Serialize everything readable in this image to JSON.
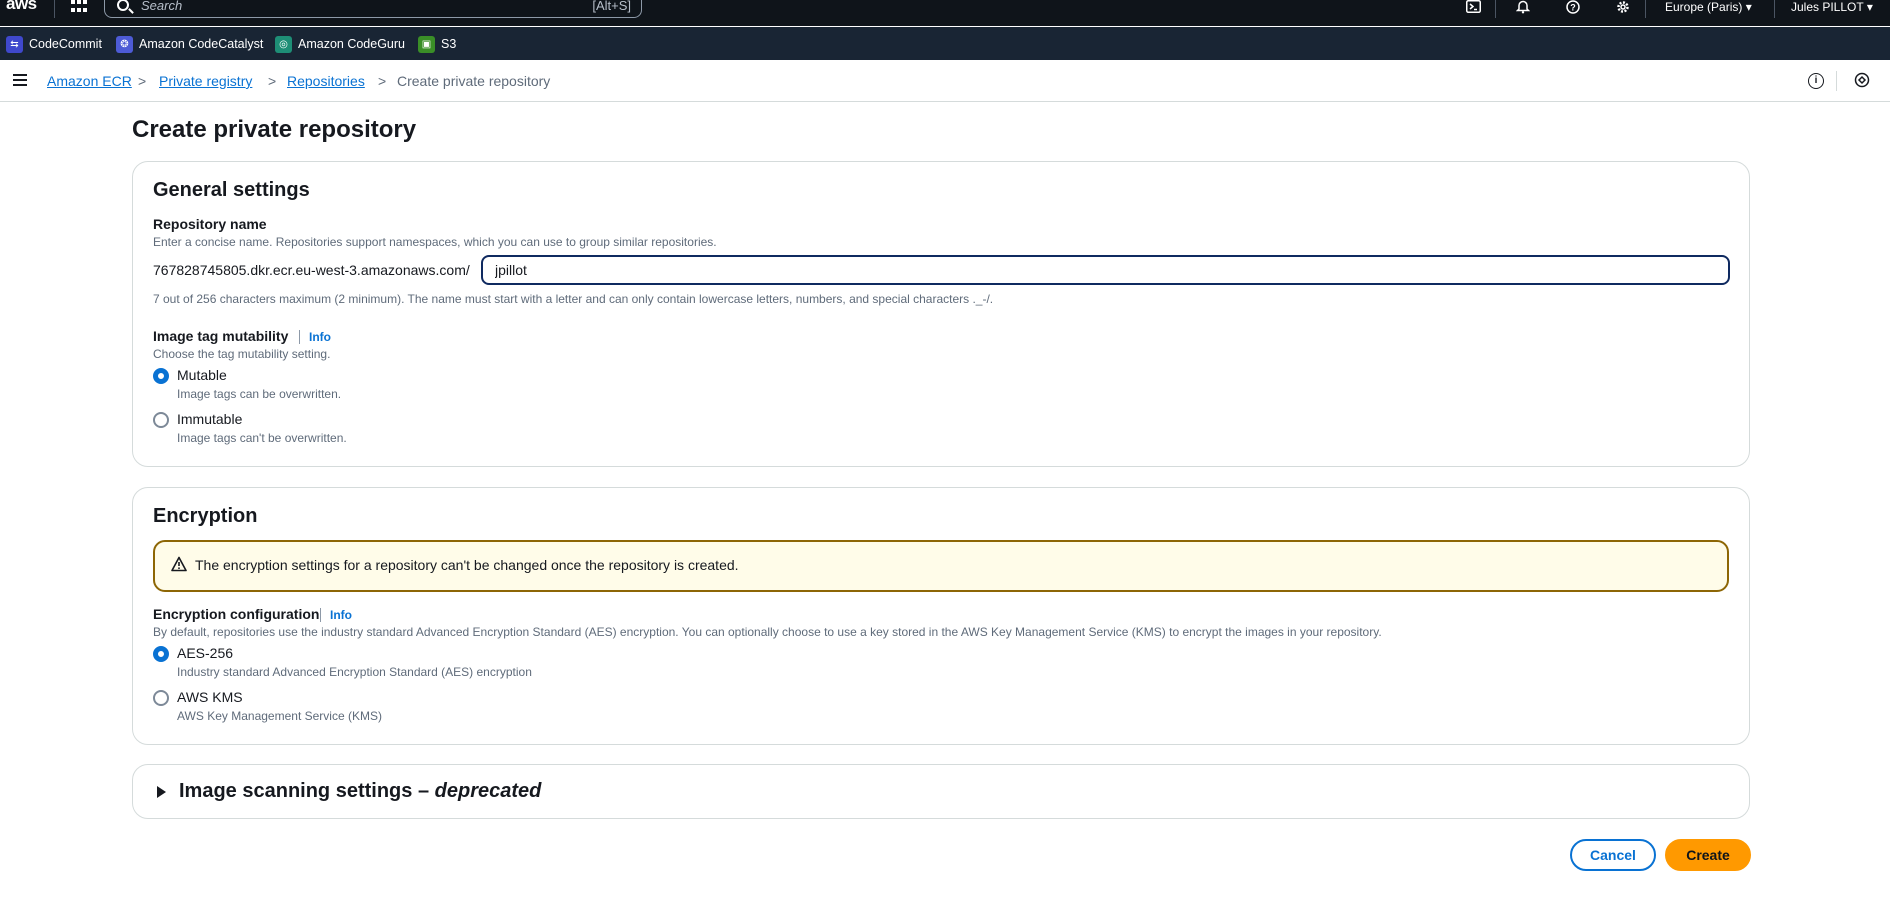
{
  "topnav": {
    "logo": "aws",
    "search_placeholder": "Search",
    "search_shortcut": "[Alt+S]",
    "region": "Europe (Paris)",
    "user": "Jules PILLOT"
  },
  "favorites": [
    {
      "label": "CodeCommit",
      "color": "#3f48cc"
    },
    {
      "label": "Amazon CodeCatalyst",
      "color": "#4d5bd6"
    },
    {
      "label": "Amazon CodeGuru",
      "color": "#1e8e76"
    },
    {
      "label": "S3",
      "color": "#3a8e27"
    }
  ],
  "breadcrumb": {
    "items": [
      "Amazon ECR",
      "Private registry",
      "Repositories"
    ],
    "current": "Create private repository"
  },
  "page": {
    "title": "Create private repository"
  },
  "general": {
    "title": "General settings",
    "repo_label": "Repository name",
    "repo_desc": "Enter a concise name. Repositories support namespaces, which you can use to group similar repositories.",
    "prefix": "767828745805.dkr.ecr.eu-west-3.amazonaws.com/",
    "repo_value": "jpillot",
    "repo_hint": "7 out of 256 characters maximum (2 minimum). The name must start with a letter and can only contain lowercase letters, numbers, and special characters ._-/.",
    "mut_label": "Image tag mutability",
    "info": "Info",
    "mut_desc": "Choose the tag mutability setting.",
    "options": [
      {
        "label": "Mutable",
        "desc": "Image tags can be overwritten.",
        "selected": true
      },
      {
        "label": "Immutable",
        "desc": "Image tags can't be overwritten.",
        "selected": false
      }
    ]
  },
  "encryption": {
    "title": "Encryption",
    "alert": "The encryption settings for a repository can't be changed once the repository is created.",
    "config_label": "Encryption configuration",
    "info": "Info",
    "config_desc": "By default, repositories use the industry standard Advanced Encryption Standard (AES) encryption. You can optionally choose to use a key stored in the AWS Key Management Service (KMS) to encrypt the images in your repository.",
    "options": [
      {
        "label": "AES-256",
        "desc": "Industry standard Advanced Encryption Standard (AES) encryption",
        "selected": true
      },
      {
        "label": "AWS KMS",
        "desc": "AWS Key Management Service (KMS)",
        "selected": false
      }
    ]
  },
  "scanning": {
    "title": "Image scanning settings",
    "title_suffix": "deprecated"
  },
  "actions": {
    "cancel": "Cancel",
    "create": "Create"
  }
}
